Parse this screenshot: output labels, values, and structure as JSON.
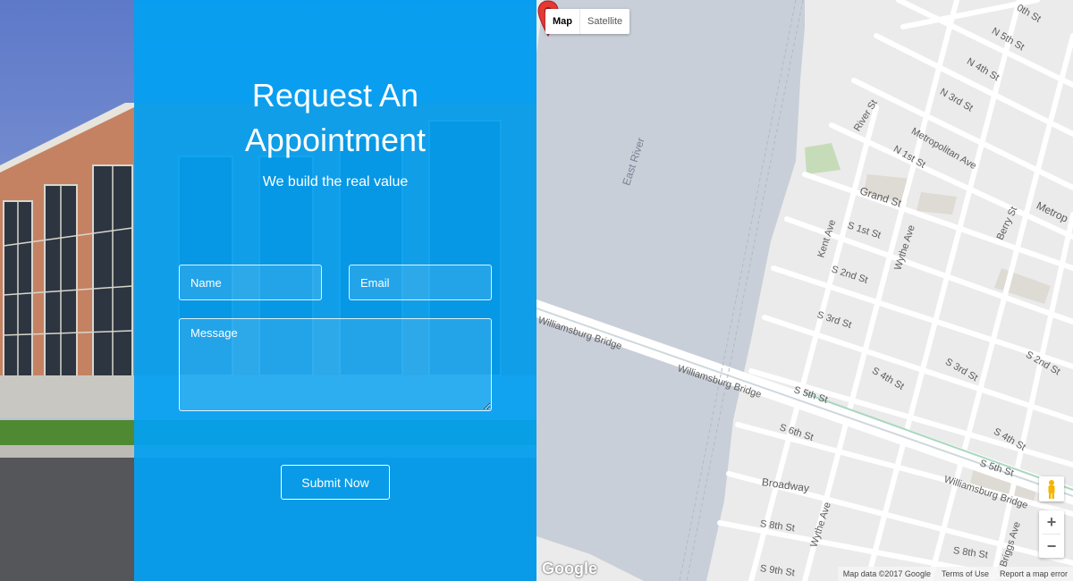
{
  "form": {
    "title_line1": "Request An",
    "title_line2": "Appointment",
    "subtitle": "We build the real value",
    "name_placeholder": "Name",
    "email_placeholder": "Email",
    "message_placeholder": "Message",
    "submit_label": "Submit Now"
  },
  "map": {
    "type_buttons": {
      "map": "Map",
      "satellite": "Satellite"
    },
    "labels": {
      "east_river": "East River",
      "williamsburg_bridge": "Williamsburg Bridge",
      "n5th": "N 5th St",
      "n4th": "N 4th St",
      "n3rd": "N 3rd St",
      "n1st": "N 1st St",
      "river_st": "River St",
      "metropolitan": "Metropolitan Ave",
      "grand": "Grand St",
      "kent": "Kent Ave",
      "wythe": "Wythe Ave",
      "berry": "Berry St",
      "s1st": "S 1st St",
      "s2nd": "S 2nd St",
      "s3rd": "S 3rd St",
      "s4th": "S 4th St",
      "s5th": "S 5th St",
      "s6th": "S 6th St",
      "s8th": "S 8th St",
      "s9th": "S 9th St",
      "broadway": "Broadway",
      "briggs": "Briggs Ave",
      "metro_edge": "Metrop",
      "top_edge": "0th St"
    },
    "zoom_in": "+",
    "zoom_out": "−",
    "attribution": {
      "data": "Map data ©2017 Google",
      "terms": "Terms of Use",
      "report": "Report a map error"
    },
    "logo": "Google"
  },
  "colors": {
    "panel": "#03a0f2",
    "pin": "#e53935",
    "water": "#c9cfd9",
    "land": "#ebebeb"
  }
}
